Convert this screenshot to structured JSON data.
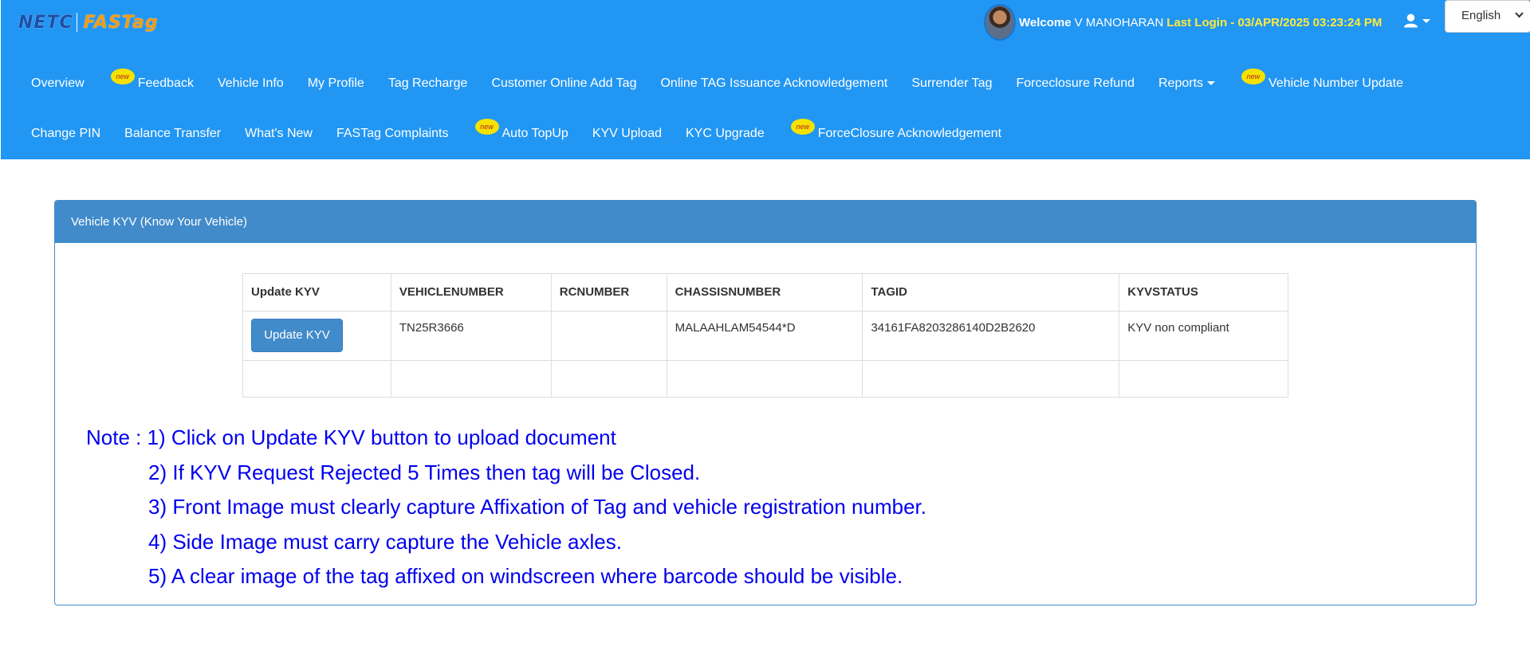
{
  "brand": {
    "logo_left": "NETC",
    "logo_right": "FASTag"
  },
  "header": {
    "welcome_label": "Welcome",
    "user_name": "V MANOHARAN",
    "last_login": "Last Login - 03/APR/2025 03:23:24 PM",
    "language": "English"
  },
  "nav": {
    "row1": [
      {
        "label": "Overview",
        "new": false
      },
      {
        "label": "Feedback",
        "new": true
      },
      {
        "label": "Vehicle Info",
        "new": false
      },
      {
        "label": "My Profile",
        "new": false
      },
      {
        "label": "Tag Recharge",
        "new": false
      },
      {
        "label": "Customer Online Add Tag",
        "new": false
      },
      {
        "label": "Online TAG Issuance Acknowledgement",
        "new": false
      },
      {
        "label": "Surrender Tag",
        "new": false
      },
      {
        "label": "Forceclosure Refund",
        "new": false
      },
      {
        "label": "Reports",
        "new": false,
        "dropdown": true
      },
      {
        "label": "Vehicle Number Update",
        "new": true
      }
    ],
    "row2": [
      {
        "label": "Change PIN",
        "new": false
      },
      {
        "label": "Balance Transfer",
        "new": false
      },
      {
        "label": "What's New",
        "new": false
      },
      {
        "label": "FASTag Complaints",
        "new": false
      },
      {
        "label": "Auto TopUp",
        "new": true
      },
      {
        "label": "KYV Upload",
        "new": false
      },
      {
        "label": "KYC Upgrade",
        "new": false
      },
      {
        "label": "ForceClosure Acknowledgement",
        "new": true
      }
    ],
    "new_badge_text": "new"
  },
  "panel": {
    "title": "Vehicle KYV (Know Your Vehicle)",
    "table": {
      "headers": [
        "Update KYV",
        "VEHICLENUMBER",
        "RCNUMBER",
        "CHASSISNUMBER",
        "TAGID",
        "KYVSTATUS"
      ],
      "rows": [
        {
          "button_label": "Update KYV",
          "vehicle_number": "TN25R3666",
          "rc_number": "",
          "chassis_number": "MALAAHLAM54544*D",
          "tag_id": "34161FA8203286140D2B2620",
          "kyv_status": "KYV non compliant"
        }
      ]
    },
    "notes": [
      "Note : 1) Click on Update KYV button to upload document",
      "2) If KYV Request Rejected 5 Times then tag will be Closed.",
      "3) Front Image must clearly capture Affixation of Tag and vehicle registration number.",
      "4) Side Image must carry capture the Vehicle axles.",
      "5) A clear image of the tag affixed on windscreen where barcode should be visible."
    ]
  },
  "colors": {
    "topbar": "#2196f3",
    "panel_heading": "#428bca",
    "last_login": "#ffeb3b",
    "note_text": "#0000ee",
    "new_badge": "#f6e200"
  },
  "icons": [
    "user-icon",
    "chevron-down-icon",
    "new-badge-icon"
  ]
}
